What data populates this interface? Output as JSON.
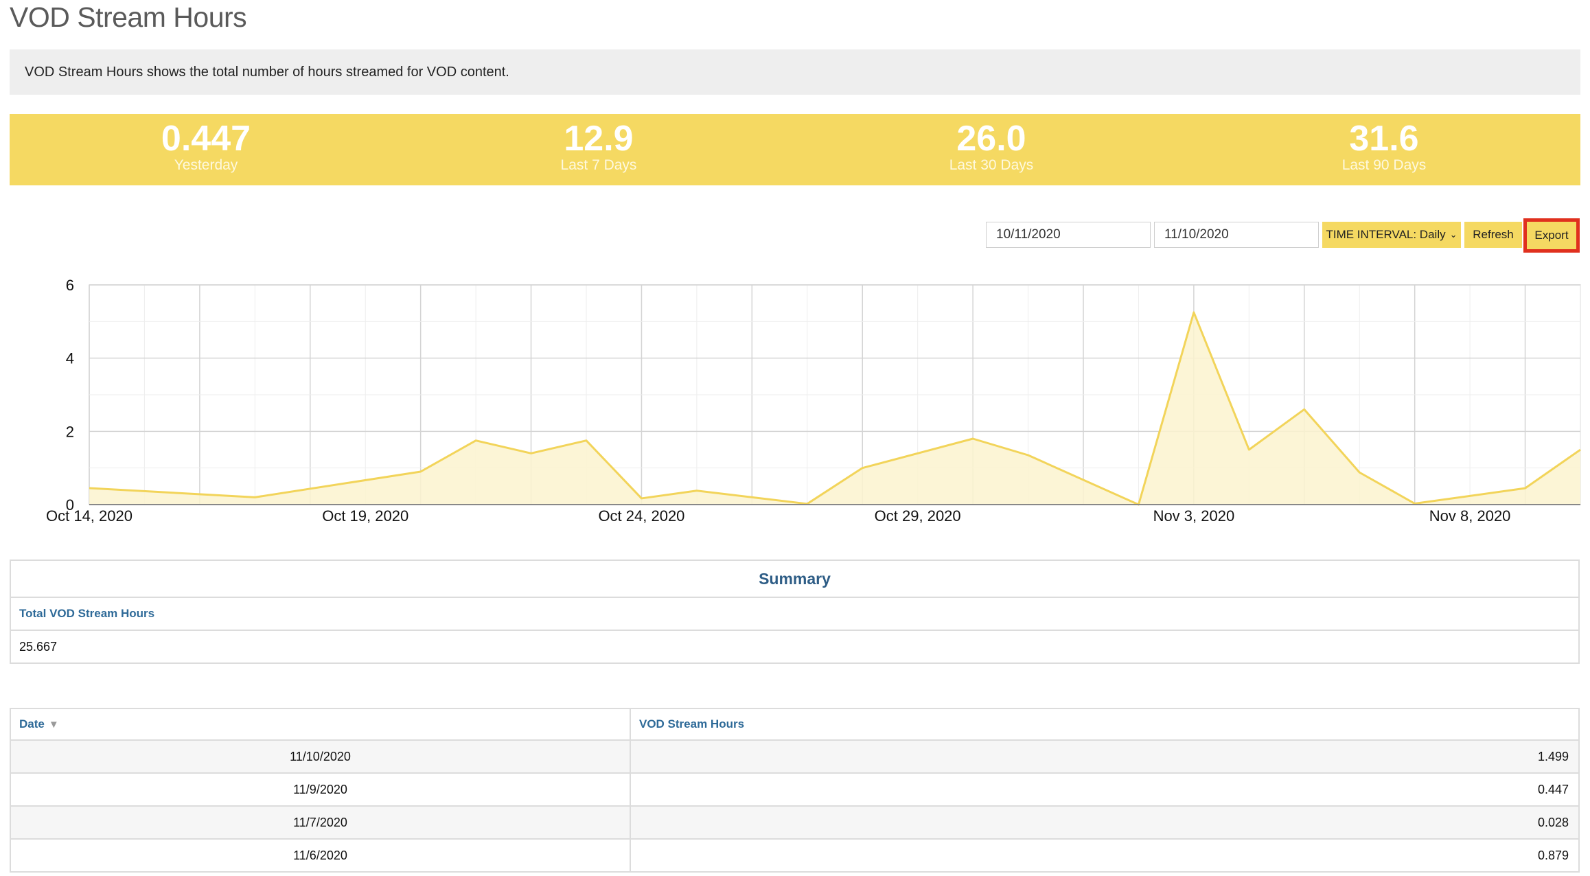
{
  "page": {
    "title": "VOD Stream Hours",
    "description": "VOD Stream Hours shows the total number of hours streamed for VOD content."
  },
  "stats": [
    {
      "value": "0.447",
      "label": "Yesterday"
    },
    {
      "value": "12.9",
      "label": "Last 7 Days"
    },
    {
      "value": "26.0",
      "label": "Last 30 Days"
    },
    {
      "value": "31.6",
      "label": "Last 90 Days"
    }
  ],
  "controls": {
    "start_date": "10/11/2020",
    "end_date": "11/10/2020",
    "interval_label": "TIME INTERVAL: Daily",
    "refresh_label": "Refresh",
    "export_label": "Export"
  },
  "colors": {
    "accent": "#f5d962",
    "line": "#f2d45a",
    "fill": "#fbf3cf",
    "highlight": "#e0301e",
    "link": "#2e6a98"
  },
  "chart_data": {
    "type": "area",
    "x": [
      "10/14/2020",
      "10/17/2020",
      "10/20/2020",
      "10/21/2020",
      "10/22/2020",
      "10/23/2020",
      "10/24/2020",
      "10/25/2020",
      "10/27/2020",
      "10/28/2020",
      "10/30/2020",
      "10/31/2020",
      "11/2/2020",
      "11/3/2020",
      "11/4/2020",
      "11/5/2020",
      "11/6/2020",
      "11/7/2020",
      "11/9/2020",
      "11/10/2020"
    ],
    "values": [
      0.45,
      0.2,
      0.9,
      1.75,
      1.4,
      1.75,
      0.17,
      0.38,
      0.02,
      1.0,
      1.8,
      1.35,
      0.0,
      5.25,
      1.5,
      2.6,
      0.879,
      0.028,
      0.447,
      1.499
    ],
    "x_ticks": [
      "Oct 14, 2020",
      "Oct 19, 2020",
      "Oct 24, 2020",
      "Oct 29, 2020",
      "Nov 3, 2020",
      "Nov 8, 2020"
    ],
    "x_tick_dates": [
      "10/14/2020",
      "10/19/2020",
      "10/24/2020",
      "10/29/2020",
      "11/3/2020",
      "11/8/2020"
    ],
    "y_ticks": [
      0,
      2,
      4,
      6
    ],
    "ylim": [
      0,
      6
    ],
    "xlim": [
      "10/14/2020",
      "11/10/2020"
    ],
    "grid": true,
    "legend": "none"
  },
  "summary": {
    "title": "Summary",
    "column": "Total VOD Stream Hours",
    "value": "25.667"
  },
  "table": {
    "columns": [
      "Date",
      "VOD Stream Hours"
    ],
    "rows": [
      {
        "date": "11/10/2020",
        "hours": "1.499"
      },
      {
        "date": "11/9/2020",
        "hours": "0.447"
      },
      {
        "date": "11/7/2020",
        "hours": "0.028"
      },
      {
        "date": "11/6/2020",
        "hours": "0.879"
      }
    ]
  }
}
